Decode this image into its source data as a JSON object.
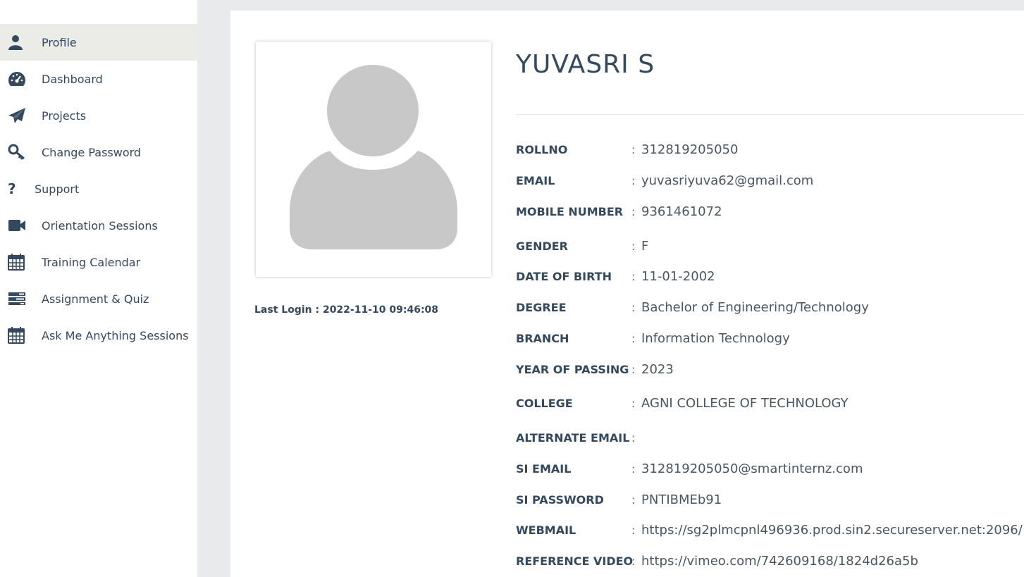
{
  "sidebar": {
    "items": [
      {
        "label": "Profile",
        "icon": "user-icon",
        "active": true
      },
      {
        "label": "Dashboard",
        "icon": "speedometer-icon",
        "active": false
      },
      {
        "label": "Projects",
        "icon": "paper-plane-icon",
        "active": false
      },
      {
        "label": "Change Password",
        "icon": "key-icon",
        "active": false
      },
      {
        "label": "Support",
        "icon": "question-icon",
        "active": false
      },
      {
        "label": "Orientation Sessions",
        "icon": "video-camera-icon",
        "active": false
      },
      {
        "label": "Training Calendar",
        "icon": "calendar-icon",
        "active": false
      },
      {
        "label": "Assignment & Quiz",
        "icon": "tasks-icon",
        "active": false
      },
      {
        "label": "Ask Me Anything Sessions",
        "icon": "calendar-icon",
        "active": false
      }
    ]
  },
  "profile": {
    "name": "YUVASRI S",
    "avatar_icon": "default-avatar-icon",
    "last_login_label": "Last Login : ",
    "last_login_value": "2022-11-10 09:46:08",
    "fields": [
      {
        "label": "ROLLNO",
        "value": "312819205050"
      },
      {
        "label": "EMAIL",
        "value": "yuvasriyuva62@gmail.com"
      },
      {
        "label": "MOBILE NUMBER",
        "value": "9361461072"
      },
      {
        "label": "GENDER",
        "value": "F"
      },
      {
        "label": "DATE OF BIRTH",
        "value": "11-01-2002"
      },
      {
        "label": "DEGREE",
        "value": "Bachelor of Engineering/Technology"
      },
      {
        "label": "BRANCH",
        "value": "Information Technology"
      },
      {
        "label": "YEAR OF PASSING",
        "value": "2023"
      },
      {
        "label": "COLLEGE",
        "value": "AGNI COLLEGE OF TECHNOLOGY"
      },
      {
        "label": "ALTERNATE EMAIL",
        "value": ""
      },
      {
        "label": "SI EMAIL",
        "value": "312819205050@smartinternz.com"
      },
      {
        "label": "SI PASSWORD",
        "value": "PNTIBMEb91"
      },
      {
        "label": "WEBMAIL",
        "value": "https://sg2plmcpnl496936.prod.sin2.secureserver.net:2096/"
      },
      {
        "label": "REFERENCE VIDEO",
        "value": "https://vimeo.com/742609168/1824d26a5b"
      }
    ]
  },
  "colors": {
    "text": "#34495e",
    "sidebar_active_bg": "#ebebe8",
    "page_bg": "#e9eaec",
    "avatar_gray": "#c8c8c8"
  }
}
